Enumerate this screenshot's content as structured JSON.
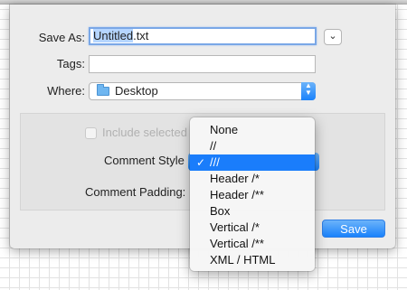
{
  "dialog": {
    "save_as_label": "Save As:",
    "filename_selected": "Untitled",
    "filename_ext": ".txt",
    "tags_label": "Tags:",
    "tags_value": "",
    "where_label": "Where:",
    "where_value": "Desktop",
    "include_label": "Include selected",
    "comment_style_label": "Comment Style",
    "comment_padding_label": "Comment Padding:",
    "save_label": "Save",
    "disclosure_glyph": "⌄",
    "stepper_up": "▲",
    "stepper_down": "▼"
  },
  "menu": {
    "selected_index": 2,
    "check_glyph": "✓",
    "items": [
      "None",
      "//",
      "///",
      "Header /*",
      "Header /**",
      "Box",
      "Vertical /*",
      "Vertical /**",
      "XML / HTML"
    ]
  },
  "colors": {
    "accent": "#1a7dfb",
    "selection_highlight": "#b5d5ff",
    "sheet_background": "#ececec"
  }
}
